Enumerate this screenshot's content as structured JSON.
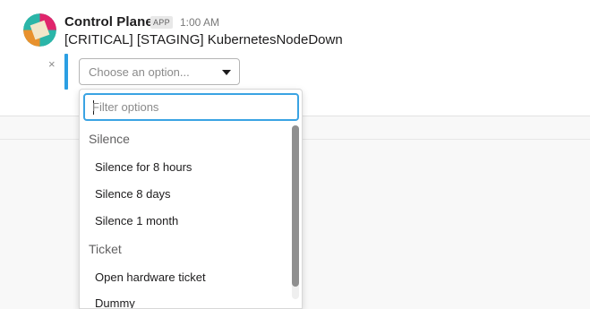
{
  "message": {
    "sender": "Control Plane",
    "app_badge": "APP",
    "timestamp": "1:00 AM",
    "text": "[CRITICAL] [STAGING] KubernetesNodeDown"
  },
  "attachment": {
    "close_glyph": "×",
    "select_placeholder": "Choose an option..."
  },
  "dropdown": {
    "filter_placeholder": "Filter options",
    "groups": [
      {
        "label": "Silence",
        "options": [
          "Silence for 8 hours",
          "Silence 8 days",
          "Silence 1 month"
        ]
      },
      {
        "label": "Ticket",
        "options": [
          "Open hardware ticket",
          "Dummy"
        ]
      }
    ]
  },
  "colors": {
    "accent_blue": "#2b9fe3",
    "focus_ring": "#3aa3e3",
    "avatar_teal": "#2bb5a8",
    "avatar_orange": "#e8912d",
    "avatar_pink": "#e0256c",
    "avatar_cream": "#f2e6c9"
  },
  "icons": {
    "avatar": "control-plane-app-logo",
    "close": "close-icon",
    "caret": "caret-down-icon"
  }
}
